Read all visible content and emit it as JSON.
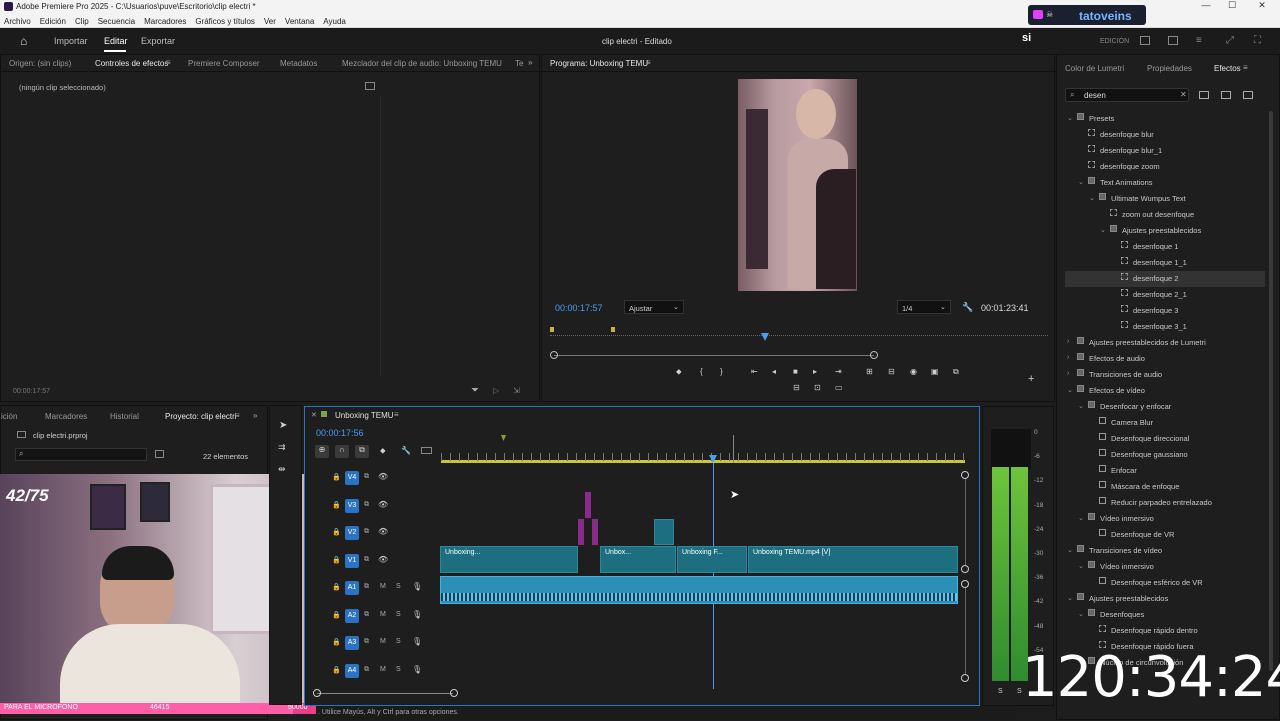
{
  "window": {
    "title": "Adobe Premiere Pro 2025 - C:\\Usuarios\\puve\\Escritorio\\clip electri *",
    "minimize": "—",
    "maximize": "☐",
    "close": "✕"
  },
  "menu": [
    "Archivo",
    "Edición",
    "Clip",
    "Secuencia",
    "Marcadores",
    "Gráficos y títulos",
    "Ver",
    "Ventana",
    "Ayuda"
  ],
  "header": {
    "home_icon": "home-icon",
    "tabs": [
      "Importar",
      "Editar",
      "Exportar"
    ],
    "active_tab": "Editar",
    "doc_title": "clip electri",
    "doc_status": "- Editado",
    "mode": "EDICIÓN"
  },
  "overlay_stream": {
    "name": "tatoveins",
    "counter": "42/75",
    "mic_text": "PARA EL MICROFONO",
    "mic_value": "46415",
    "mic_goal": "50000",
    "clock": "120:34:24",
    "si": "si"
  },
  "source_panel": {
    "tabs": [
      "Origen: (sin clips)",
      "Controles de efectos",
      "Premiere Composer",
      "Metadatos",
      "Mezclador del clip de audio: Unboxing TEMU",
      "Te"
    ],
    "active": "Controles de efectos",
    "empty_msg": "(ningún clip seleccionado)",
    "timecode": "00:00:17:57"
  },
  "program": {
    "title": "Programa: Unboxing TEMU",
    "timecode": "00:00:17:57",
    "fit": "Ajustar",
    "quality": "1/4",
    "duration": "00:01:23:41"
  },
  "project_panel": {
    "tabs": [
      "ición",
      "Marcadores",
      "Historial",
      "Proyecto: clip electri"
    ],
    "active": "Proyecto: clip electri",
    "file": "clip electri.prproj",
    "count": "22 elementos"
  },
  "timeline": {
    "sequence": "Unboxing TEMU",
    "timecode": "00:00:17:56",
    "video_tracks": [
      "V4",
      "V3",
      "V2",
      "V1"
    ],
    "audio_tracks": [
      "A1",
      "A2",
      "A3",
      "A4"
    ],
    "clips_v1": [
      "Unboxing...",
      "Unbox...",
      "Unboxing F...",
      "Unboxing TEMU.mp4 [V]"
    ],
    "mute": "M",
    "solo": "S"
  },
  "effects_panel": {
    "tabs": [
      "Color de Lumetri",
      "Propiedades",
      "Efectos"
    ],
    "active": "Efectos",
    "search": "desen",
    "tree": [
      {
        "d": 0,
        "t": "folder",
        "open": true,
        "label": "Presets"
      },
      {
        "d": 1,
        "t": "preset",
        "label": "desenfoque blur"
      },
      {
        "d": 1,
        "t": "preset",
        "label": "desenfoque blur_1"
      },
      {
        "d": 1,
        "t": "preset",
        "label": "desenfoque zoom"
      },
      {
        "d": 1,
        "t": "folder",
        "open": true,
        "label": "Text Animations"
      },
      {
        "d": 2,
        "t": "folder",
        "open": true,
        "label": "Ultimate Wumpus Text"
      },
      {
        "d": 3,
        "t": "preset",
        "label": "zoom out desenfoque"
      },
      {
        "d": 3,
        "t": "folder",
        "open": true,
        "label": "Ajustes preestablecidos"
      },
      {
        "d": 4,
        "t": "preset",
        "label": "desenfoque 1"
      },
      {
        "d": 4,
        "t": "preset",
        "label": "desenfoque 1_1"
      },
      {
        "d": 4,
        "t": "preset",
        "label": "desenfoque 2",
        "sel": true
      },
      {
        "d": 4,
        "t": "preset",
        "label": "desenfoque 2_1"
      },
      {
        "d": 4,
        "t": "preset",
        "label": "desenfoque 3"
      },
      {
        "d": 4,
        "t": "preset",
        "label": "desenfoque 3_1"
      },
      {
        "d": 0,
        "t": "folder",
        "open": false,
        "label": "Ajustes preestablecidos de Lumetri"
      },
      {
        "d": 0,
        "t": "folder",
        "open": false,
        "label": "Efectos de audio"
      },
      {
        "d": 0,
        "t": "folder",
        "open": false,
        "label": "Transiciones de audio"
      },
      {
        "d": 0,
        "t": "folder",
        "open": true,
        "label": "Efectos de vídeo"
      },
      {
        "d": 1,
        "t": "folder",
        "open": true,
        "label": "Desenfocar y enfocar"
      },
      {
        "d": 2,
        "t": "effect",
        "label": "Camera Blur"
      },
      {
        "d": 2,
        "t": "effect",
        "label": "Desenfoque direccional"
      },
      {
        "d": 2,
        "t": "effect",
        "label": "Desenfoque gaussiano"
      },
      {
        "d": 2,
        "t": "effect",
        "label": "Enfocar"
      },
      {
        "d": 2,
        "t": "effect",
        "label": "Máscara de enfoque"
      },
      {
        "d": 2,
        "t": "effect",
        "label": "Reducir parpadeo entrelazado"
      },
      {
        "d": 1,
        "t": "folder",
        "open": true,
        "label": "Vídeo inmersivo"
      },
      {
        "d": 2,
        "t": "effect",
        "label": "Desenfoque de VR"
      },
      {
        "d": 0,
        "t": "folder",
        "open": true,
        "label": "Transiciones de vídeo"
      },
      {
        "d": 1,
        "t": "folder",
        "open": true,
        "label": "Vídeo inmersivo"
      },
      {
        "d": 2,
        "t": "effect",
        "label": "Desenfoque esférico de VR"
      },
      {
        "d": 0,
        "t": "folder",
        "open": true,
        "label": "Ajustes preestablecidos"
      },
      {
        "d": 1,
        "t": "folder",
        "open": true,
        "label": "Desenfoques"
      },
      {
        "d": 2,
        "t": "preset",
        "label": "Desenfoque rápido dentro"
      },
      {
        "d": 2,
        "t": "preset",
        "label": "Desenfoque rápido fuera"
      },
      {
        "d": 1,
        "t": "folder",
        "open": true,
        "label": "Núcleo de circunvolución"
      }
    ]
  },
  "audio_meter": {
    "scale": [
      "0",
      "-6",
      "-12",
      "-18",
      "-24",
      "-30",
      "-36",
      "-42",
      "-48",
      "-54"
    ],
    "s1": "S",
    "s2": "S"
  },
  "status_bar": ". Utilice Mayús, Alt y Ctrl para otras opciones."
}
